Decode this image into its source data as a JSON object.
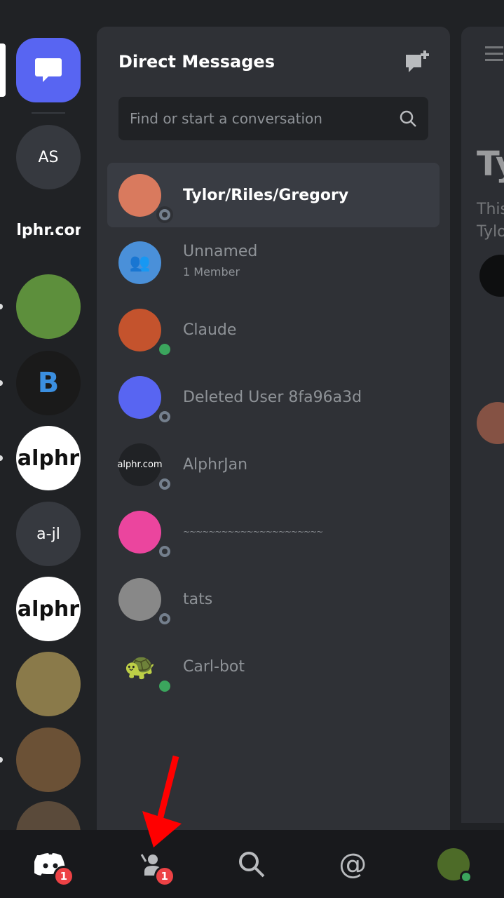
{
  "servers": [
    {
      "label": "",
      "icon": "dm-chat-icon"
    },
    {
      "label": "AS"
    },
    {
      "label": "alphr.com"
    },
    {
      "label": ""
    },
    {
      "label": ""
    },
    {
      "label": "alphr"
    },
    {
      "label": "a-jl"
    },
    {
      "label": "alphr"
    },
    {
      "label": ""
    },
    {
      "label": ""
    },
    {
      "label": ""
    }
  ],
  "dm": {
    "title": "Direct Messages",
    "search_placeholder": "Find or start a conversation",
    "conversations": [
      {
        "name": "Tylor/Riles/Gregory",
        "status": "offline",
        "selected": true
      },
      {
        "name": "Unnamed",
        "sub": "1 Member"
      },
      {
        "name": "Claude",
        "status": "online"
      },
      {
        "name": "Deleted User 8fa96a3d",
        "status": "offline"
      },
      {
        "name": "AlphrJan",
        "status": "offline",
        "avatar_text": "alphr.com"
      },
      {
        "name": "~~~~~~~~~~~~~~~~~~~~~~",
        "status": "offline"
      },
      {
        "name": "tats",
        "status": "offline"
      },
      {
        "name": "Carl-bot",
        "status": "online"
      }
    ]
  },
  "right_peek": {
    "title": "Ty",
    "line1": "This",
    "line2": "Tylo"
  },
  "nav": {
    "home_badge": "1",
    "friends_badge": "1"
  },
  "colors": {
    "accent": "#5865f2",
    "online": "#3ba55d",
    "badge": "#ed4245",
    "arrow": "#ff0000"
  }
}
